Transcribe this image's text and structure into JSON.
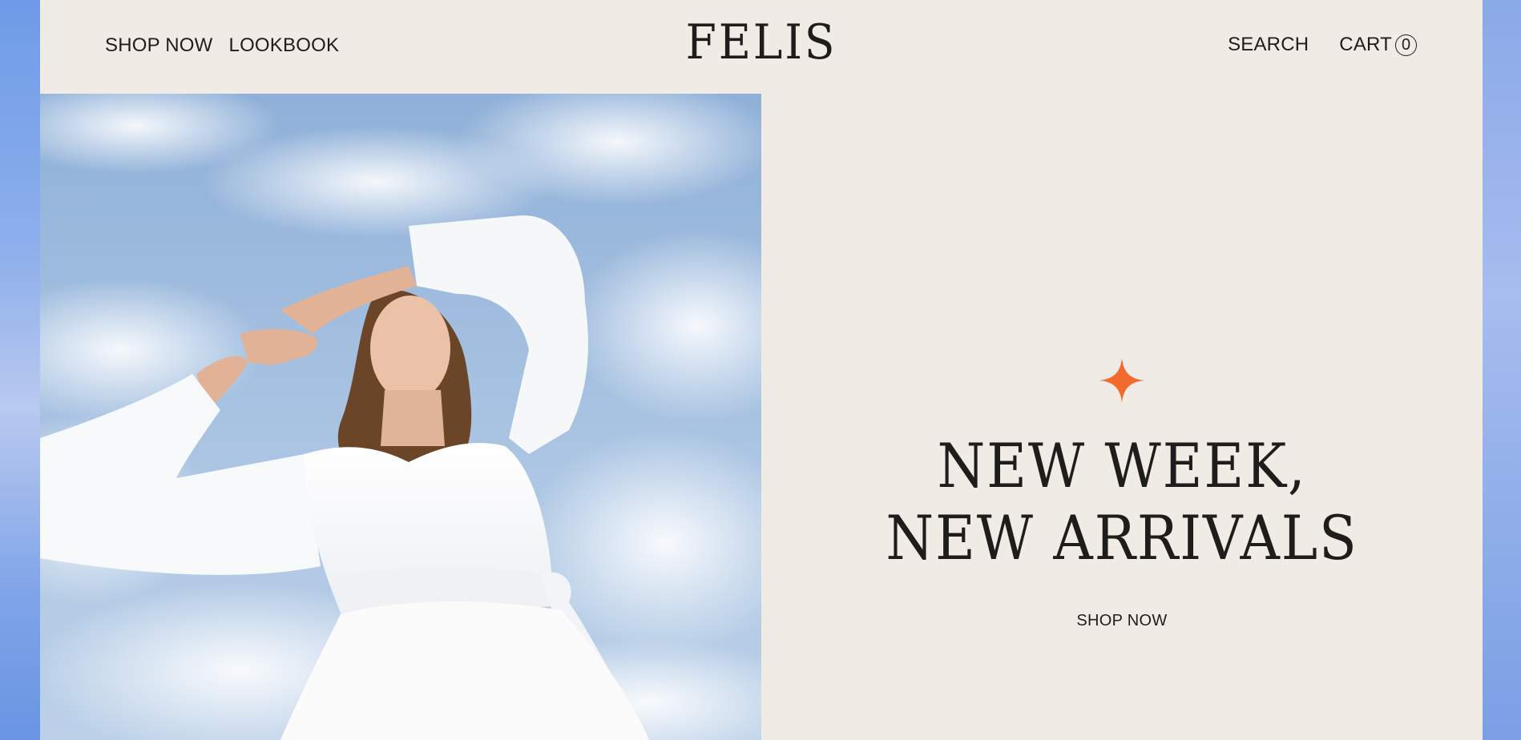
{
  "header": {
    "nav_left": [
      "SHOP NOW",
      "LOOKBOOK"
    ],
    "logo": "FELIS",
    "search_label": "SEARCH",
    "cart_label": "CART",
    "cart_count": "0"
  },
  "hero": {
    "headline_line1": "NEW WEEK,",
    "headline_line2": "NEW ARRIVALS",
    "cta_label": "SHOP NOW",
    "accent_color": "#f26a2e",
    "image_subject": "model-in-white-dress-against-sky"
  },
  "colors": {
    "page_background": "#f1ebe6",
    "text": "#1f1d1b",
    "backdrop": "#7fa4e8"
  }
}
